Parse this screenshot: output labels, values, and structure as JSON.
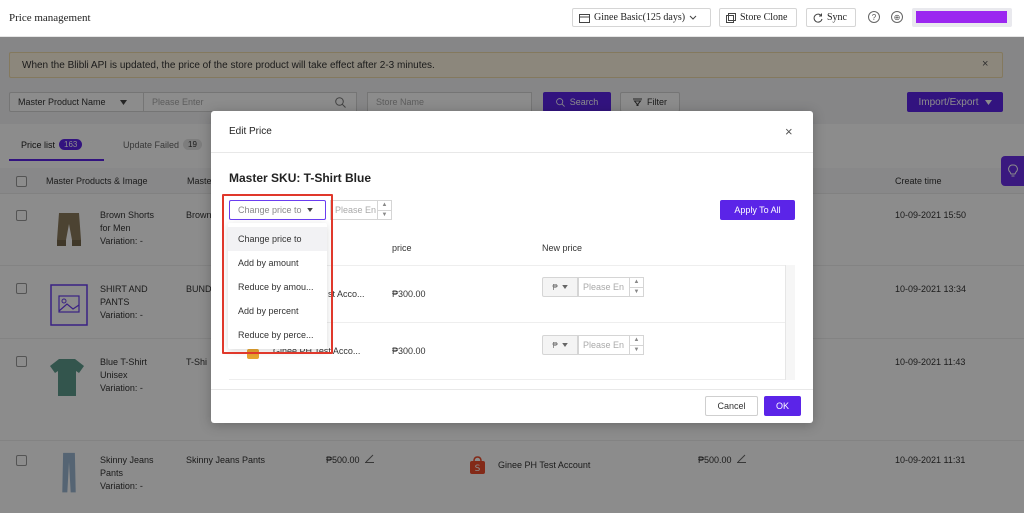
{
  "header": {
    "page_title": "Price management",
    "plan_label": "Ginee Basic(125 days)",
    "store_clone_label": "Store Clone",
    "sync_label": "Sync",
    "help_glyph": "?",
    "globe_glyph": "⊕"
  },
  "notice": {
    "text": "When the Blibli API is updated, the price of the store product will take effect after 2-3 minutes.",
    "close_glyph": "×"
  },
  "filters": {
    "field_select": "Master Product Name",
    "search_placeholder": "Please Enter",
    "store_placeholder": "Store Name",
    "search_button": "Search",
    "filter_button": "Filter",
    "import_export_button": "Import/Export"
  },
  "tabs": [
    {
      "label": "Price list",
      "count": "163"
    },
    {
      "label": "Update Failed",
      "count": "19"
    }
  ],
  "table": {
    "headers": [
      "Master Products & Image",
      "Maste",
      "Create time"
    ],
    "rows": [
      {
        "name_l1": "Brown Shorts",
        "name_l2": "for Men",
        "variation": "Variation: -",
        "sku": "Brown",
        "create_time": "10-09-2021 15:50"
      },
      {
        "name_l1": "SHIRT AND",
        "name_l2": "PANTS",
        "variation": "Variation: -",
        "sku": "BUND",
        "create_time": "10-09-2021 13:34"
      },
      {
        "name_l1": "Blue T-Shirt",
        "name_l2": "Unisex",
        "variation": "Variation: -",
        "sku": "T-Shi",
        "create_time": "10-09-2021 11:43"
      },
      {
        "name_l1": "Skinny Jeans",
        "name_l2": "Pants",
        "variation": "Variation: -",
        "sku": "Skinny Jeans Pants",
        "price": "₱500.00",
        "store": "Ginee PH Test Account",
        "new_price": "₱500.00",
        "create_time": "10-09-2021 11:31"
      }
    ]
  },
  "modal": {
    "title": "Edit Price",
    "close_glyph": "×",
    "sku_title": "Master SKU: T-Shirt Blue",
    "price_type_selected": "Change price to",
    "amount_placeholder": "Please En",
    "apply_all": "Apply To All",
    "col_price": "price",
    "col_new_price": "New price",
    "rows": [
      {
        "store": "st Acco...",
        "price": "₱300.00",
        "currency": "₱",
        "placeholder": "Please En"
      },
      {
        "store": "Ginee PH Test Acco...",
        "price": "₱300.00",
        "currency": "₱",
        "placeholder": "Please En"
      }
    ],
    "cancel": "Cancel",
    "ok": "OK"
  },
  "dropdown": {
    "options": [
      "Change price to",
      "Add by amount",
      "Reduce by amou...",
      "Add by percent",
      "Reduce by perce..."
    ]
  },
  "colors": {
    "accent": "#5b24e8",
    "highlight": "#e0382b",
    "user_bar": "#9b27f0"
  }
}
